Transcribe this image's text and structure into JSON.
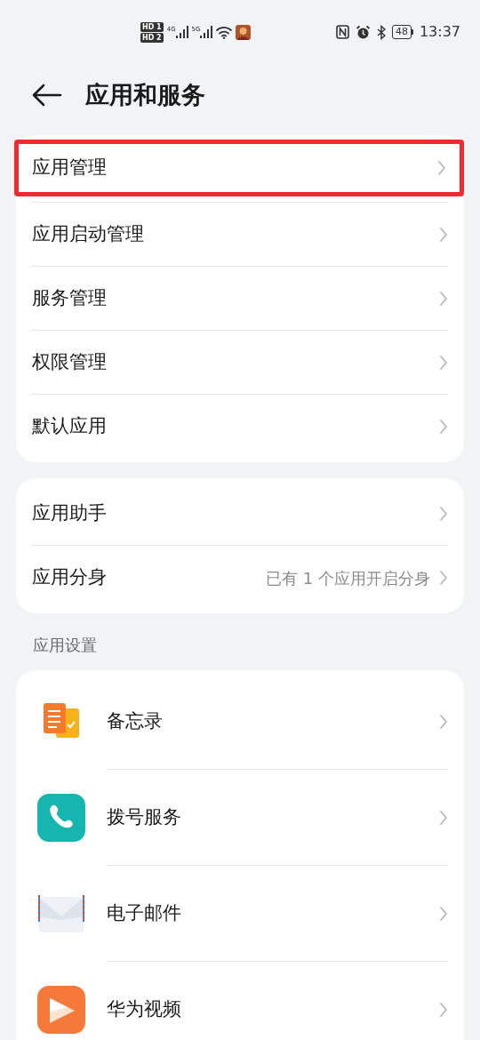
{
  "status_bar": {
    "sim_1": "HD 1",
    "sim_2": "HD 2",
    "network_1": "4G",
    "network_2": "5G",
    "battery": "48",
    "time": "13:37"
  },
  "header": {
    "title": "应用和服务"
  },
  "groups": [
    {
      "items": [
        {
          "label": "应用管理",
          "highlighted": true
        },
        {
          "label": "应用启动管理",
          "highlighted": false
        },
        {
          "label": "服务管理",
          "highlighted": false
        },
        {
          "label": "权限管理",
          "highlighted": false
        },
        {
          "label": "默认应用",
          "highlighted": false
        }
      ]
    },
    {
      "items": [
        {
          "label": "应用助手",
          "highlighted": false
        },
        {
          "label": "应用分身",
          "value": "已有 1 个应用开启分身",
          "highlighted": false
        }
      ]
    }
  ],
  "app_settings": {
    "heading": "应用设置",
    "items": [
      {
        "label": "备忘录",
        "kind": "memo"
      },
      {
        "label": "拨号服务",
        "kind": "dialer"
      },
      {
        "label": "电子邮件",
        "kind": "mail"
      },
      {
        "label": "华为视频",
        "kind": "video"
      }
    ]
  }
}
